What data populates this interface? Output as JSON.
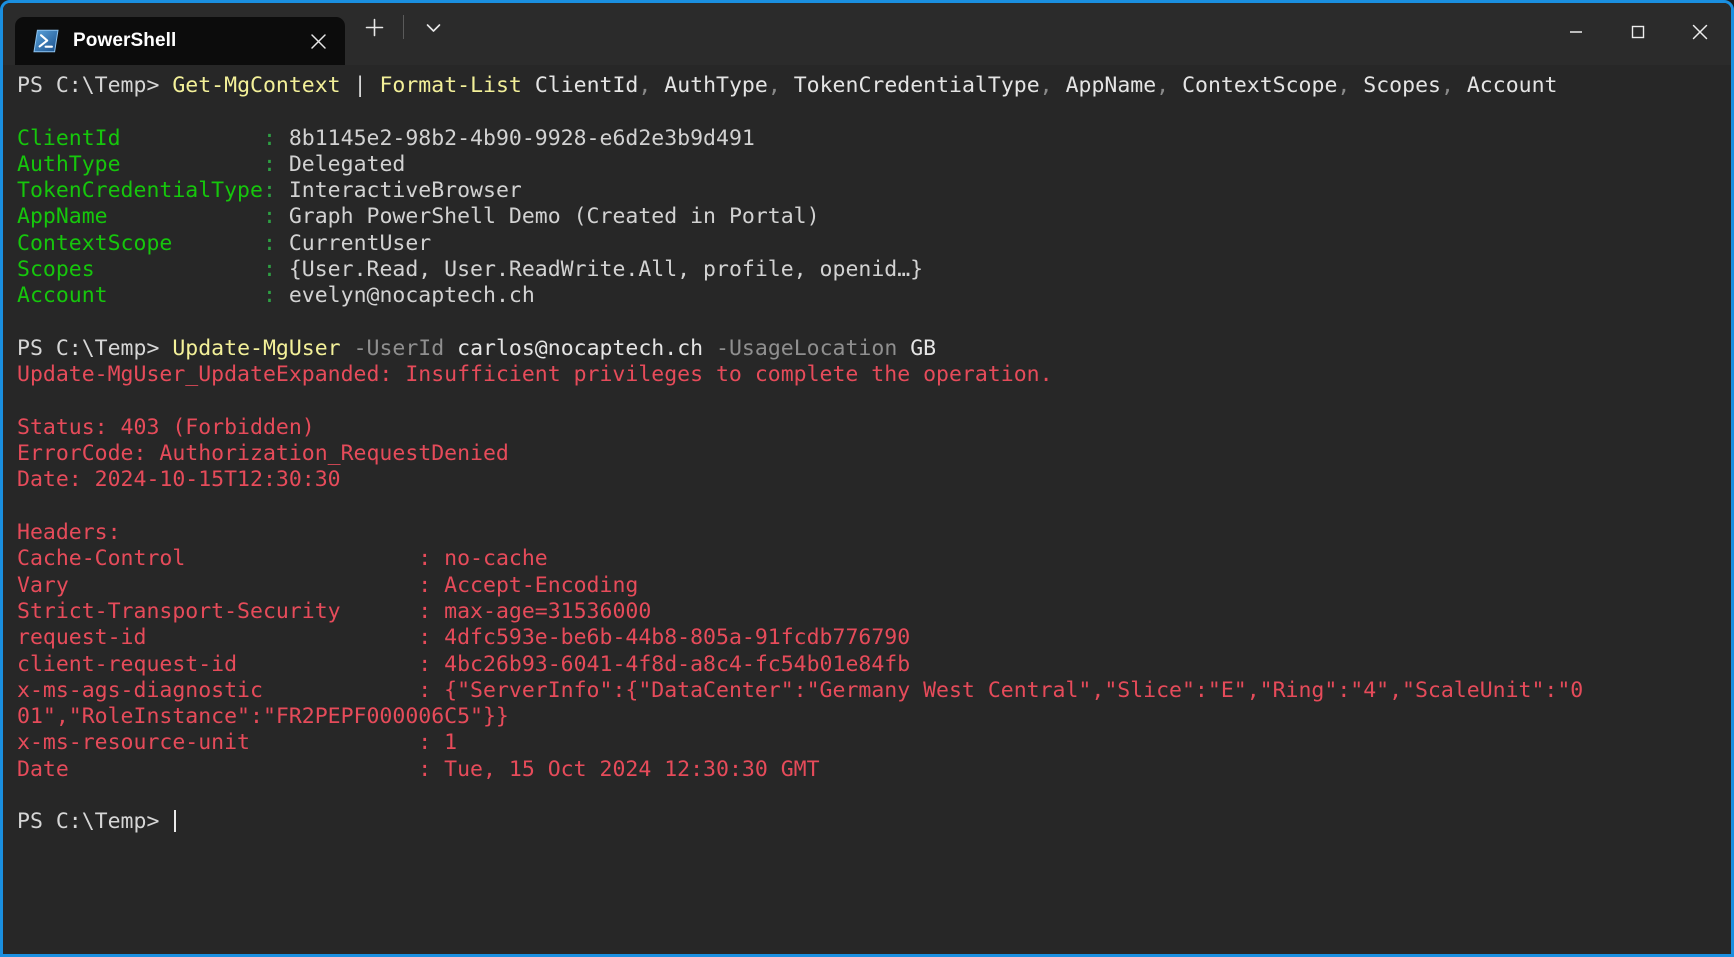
{
  "window": {
    "accent_color": "#1a8fe0",
    "titlebar_bg": "#2b2b2b",
    "terminal_bg": "#272727",
    "controls": {
      "minimize_label": "Minimize",
      "maximize_label": "Maximize",
      "close_label": "Close"
    }
  },
  "tab": {
    "title": "PowerShell",
    "icon": "powershell-icon",
    "close_label": "Close tab",
    "new_tab_label": "New tab",
    "dropdown_label": "Open new tab dropdown"
  },
  "terminal": {
    "prompt": "PS C:\\Temp> ",
    "colors": {
      "prompt": "#d6d6d6",
      "cmdlet": "#f3f099",
      "parameter": "#8f8f8f",
      "property": "#16c60c",
      "value": "#d2d2d2",
      "error": "#e64b5a"
    },
    "command1": {
      "cmdlet1": "Get-MgContext",
      "pipe": " | ",
      "cmdlet2": "Format-List",
      "properties": "ClientId, AuthType, TokenCredentialType, AppName, ContextScope, Scopes, Account"
    },
    "context_properties": [
      {
        "name": "ClientId",
        "value": "8b1145e2-98b2-4b90-9928-e6d2e3b9d491"
      },
      {
        "name": "AuthType",
        "value": "Delegated"
      },
      {
        "name": "TokenCredentialType",
        "value": "InteractiveBrowser"
      },
      {
        "name": "AppName",
        "value": "Graph PowerShell Demo (Created in Portal)"
      },
      {
        "name": "ContextScope",
        "value": "CurrentUser"
      },
      {
        "name": "Scopes",
        "value": "{User.Read, User.ReadWrite.All, profile, openid…}"
      },
      {
        "name": "Account",
        "value": "evelyn@nocaptech.ch"
      }
    ],
    "command2": {
      "cmdlet": "Update-MgUser",
      "param1": "-UserId",
      "arg1": "carlos@nocaptech.ch",
      "param2": "-UsageLocation",
      "arg2": "GB"
    },
    "error": {
      "message": "Update-MgUser_UpdateExpanded: Insufficient privileges to complete the operation.",
      "status": "Status: 403 (Forbidden)",
      "error_code": "ErrorCode: Authorization_RequestDenied",
      "date": "Date: 2024-10-15T12:30:30",
      "headers_label": "Headers:",
      "headers": [
        {
          "name": "Cache-Control",
          "value": "no-cache"
        },
        {
          "name": "Vary",
          "value": "Accept-Encoding"
        },
        {
          "name": "Strict-Transport-Security",
          "value": "max-age=31536000"
        },
        {
          "name": "request-id",
          "value": "4dfc593e-be6b-44b8-805a-91fcdb776790"
        },
        {
          "name": "client-request-id",
          "value": "4bc26b93-6041-4f8d-a8c4-fc54b01e84fb"
        },
        {
          "name": "x-ms-ags-diagnostic",
          "value": "{\"ServerInfo\":{\"DataCenter\":\"Germany West Central\",\"Slice\":\"E\",\"Ring\":\"4\",\"ScaleUnit\":\"0"
        },
        {
          "name": "",
          "value": "01\",\"RoleInstance\":\"FR2PEPF000006C5\"}}",
          "continuation": true
        },
        {
          "name": "x-ms-resource-unit",
          "value": "1"
        },
        {
          "name": "Date",
          "value": "Tue, 15 Oct 2024 12:30:30 GMT"
        }
      ]
    },
    "final_prompt": "PS C:\\Temp> "
  }
}
